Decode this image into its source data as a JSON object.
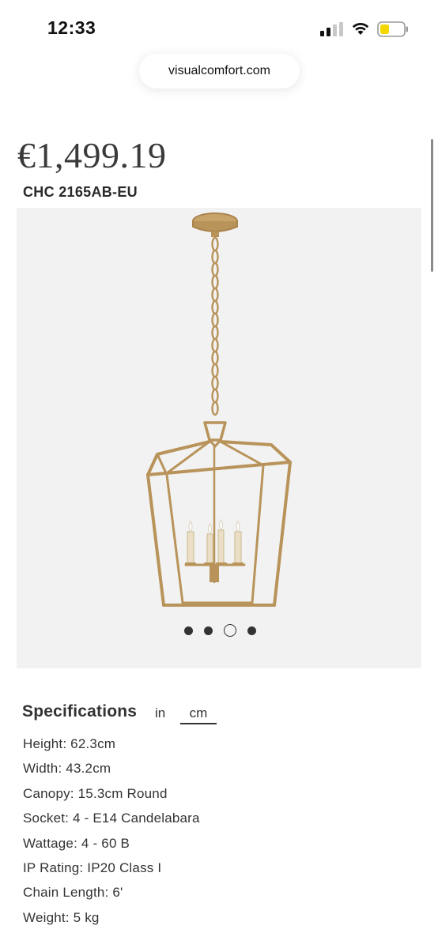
{
  "status": {
    "time": "12:33",
    "colors": {
      "battery_fill": "#f5d700"
    }
  },
  "browser": {
    "url": "visualcomfort.com"
  },
  "product": {
    "price": "€1,499.19",
    "sku": "CHC 2165AB-EU",
    "image": {
      "subject": "brass-lantern-pendant",
      "carousel": {
        "total": 4,
        "active_index": 2
      }
    }
  },
  "specifications": {
    "title": "Specifications",
    "units": [
      {
        "label": "in",
        "selected": false
      },
      {
        "label": "cm",
        "selected": true
      }
    ],
    "items": [
      "Height: 62.3cm",
      "Width: 43.2cm",
      "Canopy: 15.3cm Round",
      "Socket: 4 - E14 Candelabara",
      "Wattage: 4 - 60 B",
      "IP Rating: IP20 Class I",
      "Chain Length: 6'",
      "Weight: 5 kg"
    ]
  },
  "colors": {
    "brass": "#b8935a",
    "panel_bg": "#f2f2f2",
    "text": "#333333"
  }
}
